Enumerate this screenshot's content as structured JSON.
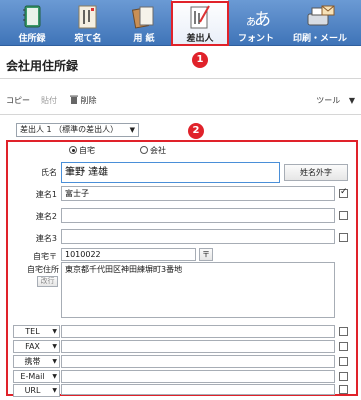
{
  "ribbon": {
    "items": [
      {
        "label": "住所録",
        "icon": "address-book-icon"
      },
      {
        "label": "宛て名",
        "icon": "addressee-icon"
      },
      {
        "label": "用 紙",
        "icon": "paper-icon"
      },
      {
        "label": "差出人",
        "icon": "sender-icon"
      },
      {
        "label": "フォント",
        "icon": "font-icon"
      },
      {
        "label": "印刷・メール",
        "icon": "print-mail-icon"
      }
    ],
    "active_item": "差出人"
  },
  "annotations": {
    "badge1": "1",
    "badge2": "2"
  },
  "page_title": "会社用住所録",
  "toolbar": {
    "copy": "コピー",
    "paste": "貼付",
    "delete": "削除",
    "tools": "ツール"
  },
  "sender_select": {
    "value": "差出人 1 （標準の差出人）"
  },
  "address_type": {
    "home": "自宅",
    "company": "会社",
    "selected": "自宅"
  },
  "form": {
    "name_label": "氏名",
    "name_value": "筆野 達雄",
    "name_gaiji_button": "姓名外字",
    "renmei1_label": "連名1",
    "renmei1_value": "富士子",
    "renmei1_checked": true,
    "renmei2_label": "連名2",
    "renmei2_value": "",
    "renmei3_label": "連名3",
    "renmei3_value": "",
    "postal_label": "自宅〒",
    "postal_value": "1010022",
    "postal_button": "〒",
    "address_label": "自宅住所",
    "address_value": "東京都千代田区神田練塀町3番地",
    "newline_button": "改行"
  },
  "contacts": [
    {
      "type": "TEL",
      "value": ""
    },
    {
      "type": "FAX",
      "value": ""
    },
    {
      "type": "携帯",
      "value": ""
    },
    {
      "type": "E-Mail",
      "value": ""
    },
    {
      "type": "URL",
      "value": ""
    }
  ],
  "colors": {
    "ribbon": "#4a7fc1",
    "highlight": "#e0222a",
    "focus": "#4a8fd8"
  }
}
